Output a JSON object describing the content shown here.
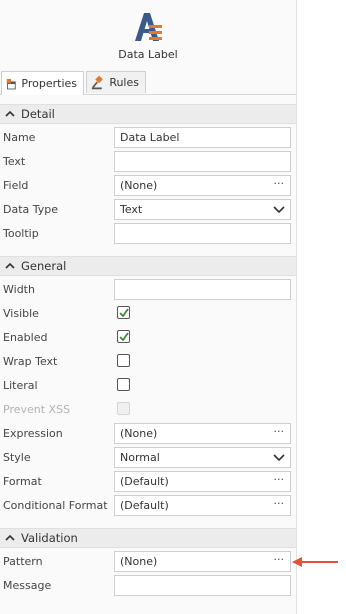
{
  "header": {
    "title": "Data Label",
    "icon": "data-label-icon"
  },
  "tabs": [
    {
      "label": "Properties",
      "icon": "properties-icon",
      "active": true
    },
    {
      "label": "Rules",
      "icon": "gavel-icon",
      "active": false
    }
  ],
  "sections": {
    "detail": "Detail",
    "general": "General",
    "validation": "Validation"
  },
  "fields": {
    "name": {
      "label": "Name",
      "value": "Data Label"
    },
    "text": {
      "label": "Text",
      "value": ""
    },
    "field": {
      "label": "Field",
      "value": "(None)"
    },
    "data_type": {
      "label": "Data Type",
      "value": "Text"
    },
    "tooltip": {
      "label": "Tooltip",
      "value": ""
    },
    "width": {
      "label": "Width",
      "value": ""
    },
    "visible": {
      "label": "Visible",
      "checked": true
    },
    "enabled": {
      "label": "Enabled",
      "checked": true
    },
    "wrap_text": {
      "label": "Wrap Text",
      "checked": false
    },
    "literal": {
      "label": "Literal",
      "checked": false
    },
    "prevent_xss": {
      "label": "Prevent XSS",
      "checked": false,
      "disabled": true
    },
    "expression": {
      "label": "Expression",
      "value": "(None)"
    },
    "style": {
      "label": "Style",
      "value": "Normal"
    },
    "format": {
      "label": "Format",
      "value": "(Default)"
    },
    "conditional_format": {
      "label": "Conditional Format",
      "value": "(Default)"
    },
    "pattern": {
      "label": "Pattern",
      "value": "(None)"
    },
    "message": {
      "label": "Message",
      "value": ""
    }
  },
  "ellipsis": "...",
  "colors": {
    "accent_orange": "#e07a2e",
    "icon_blue": "#3a5a8c",
    "check_green": "#3a8a3a",
    "arrow_red": "#e0533a"
  }
}
